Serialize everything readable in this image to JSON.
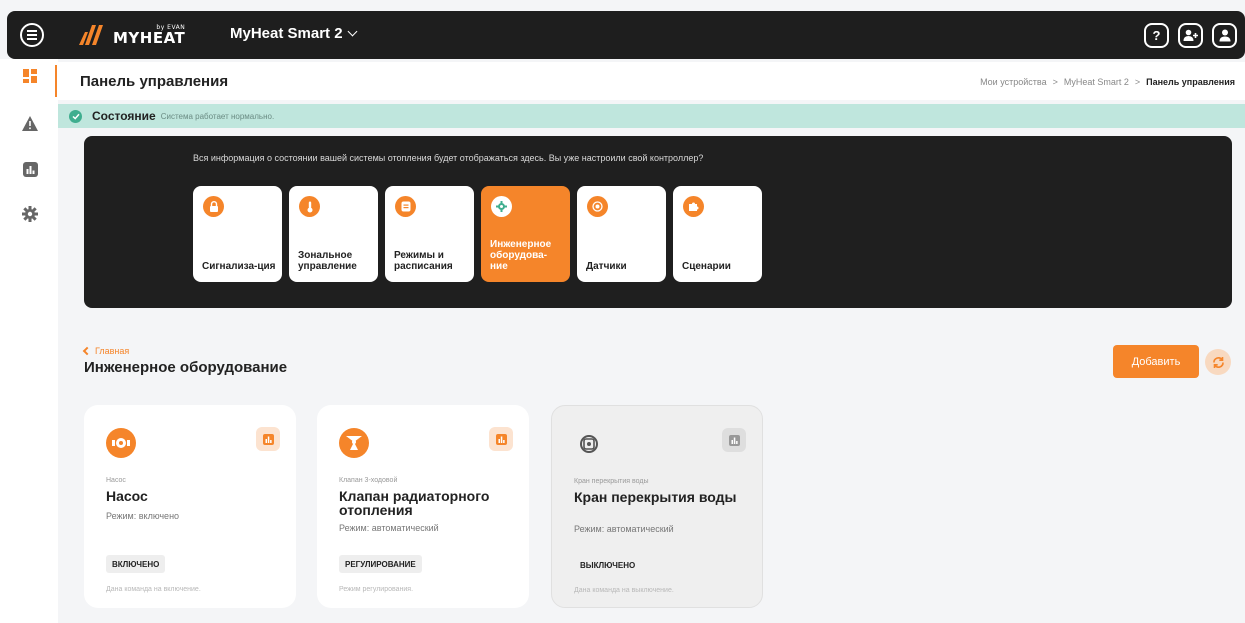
{
  "header": {
    "logo_text": "MYHEAT",
    "logo_sub": "by EVAN",
    "device_name": "MyHeat Smart 2",
    "icons": [
      "help-icon",
      "add-user-icon",
      "profile-icon"
    ],
    "help_glyph": "?"
  },
  "sidebar": {
    "items": [
      {
        "name": "dashboard-icon",
        "active": true
      },
      {
        "name": "alert-icon",
        "active": false
      },
      {
        "name": "statistics-icon",
        "active": false
      },
      {
        "name": "settings-icon",
        "active": false
      }
    ]
  },
  "page": {
    "title": "Панель управления",
    "breadcrumb": [
      "Мои устройства",
      "MyHeat Smart 2",
      "Панель управления"
    ],
    "breadcrumb_sep": ">"
  },
  "status": {
    "label": "Состояние",
    "text": "Система работает нормально."
  },
  "panel": {
    "intro": "Вся информация о состоянии вашей системы отопления будет отображаться здесь. Вы уже настроили свой контроллер?",
    "tiles": [
      {
        "label": "Сигнализа-ция",
        "icon": "lock-icon",
        "active": false
      },
      {
        "label": "Зональное управление",
        "icon": "thermometer-icon",
        "active": false
      },
      {
        "label": "Режимы и расписания",
        "icon": "schedule-icon",
        "active": false
      },
      {
        "label": "Инженерное оборудова-ние",
        "icon": "gear-icon",
        "active": true
      },
      {
        "label": "Датчики",
        "icon": "sensor-icon",
        "active": false
      },
      {
        "label": "Сценарии",
        "icon": "puzzle-icon",
        "active": false
      }
    ]
  },
  "section": {
    "back_label": "Главная",
    "title": "Инженерное оборудование",
    "add_label": "Добавить"
  },
  "cards": [
    {
      "type": "Насос",
      "name": "Насос",
      "mode": "Режим: включено",
      "badge": "ВКЛЮЧЕНО",
      "note": "Дана команда на включение.",
      "icon": "pump-icon"
    },
    {
      "type": "Клапан 3-ходовой",
      "name": "Клапан радиаторного отопления",
      "mode": "Режим: автоматический",
      "badge": "РЕГУЛИРОВАНИЕ",
      "note": "Режим регулирования.",
      "icon": "valve-icon"
    },
    {
      "type": "Кран перекрытия воды",
      "name": "Кран перекрытия воды",
      "mode": "Режим: автоматический",
      "badge": "ВЫКЛЮЧЕНО",
      "note": "Дана команда на выключение.",
      "icon": "water-tap-icon"
    }
  ],
  "colors": {
    "accent": "#f5852a",
    "header_bg": "#1e1e1e",
    "status_bg": "#bfe6dd",
    "status_ok": "#3fae8f"
  }
}
